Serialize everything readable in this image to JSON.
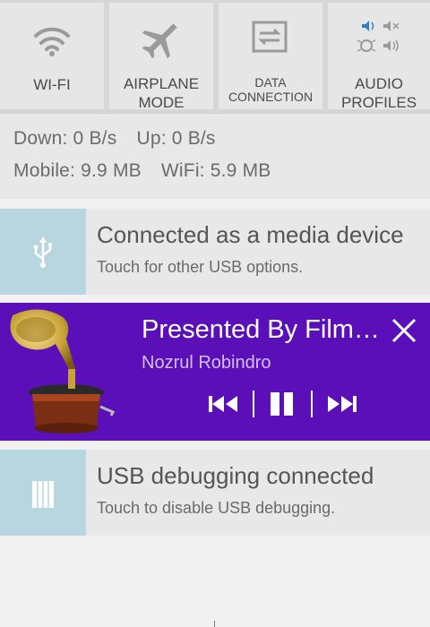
{
  "quick_settings": {
    "tiles": [
      {
        "label": "WI-FI"
      },
      {
        "label": "AIRPLANE MODE",
        "line1": "AIRPLANE",
        "line2": "MODE"
      },
      {
        "label": "DATA CONNECTION",
        "line1": "DATA",
        "line2": "CONNECTION"
      },
      {
        "label": "AUDIO PROFILES",
        "line1": "AUDIO",
        "line2": "PROFILES"
      }
    ]
  },
  "traffic": {
    "down": "Down: 0 B/s",
    "up": "Up: 0 B/s",
    "mobile": "Mobile: 9.9 MB",
    "wifi": "WiFi: 5.9 MB"
  },
  "usb_notification": {
    "title": "Connected as a media device",
    "subtitle": "Touch for other USB options."
  },
  "media": {
    "title": "Presented By Film…",
    "artist": "Nozrul Robindro",
    "accent": "#5a0fb8"
  },
  "debug_notification": {
    "title": "USB debugging connected",
    "subtitle": "Touch to disable USB debugging."
  },
  "colors": {
    "tile_bg": "#e6e6e6",
    "icon_panel": "#b7d6e0",
    "media_bg": "#5a0fb8"
  }
}
